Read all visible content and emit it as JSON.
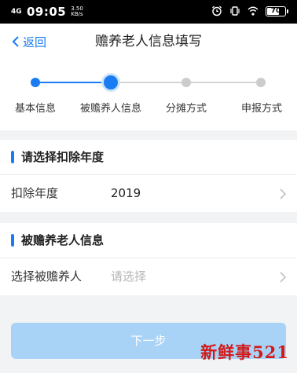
{
  "status_bar": {
    "network": "4G",
    "time": "09:05",
    "speed": "3.50 KB/s",
    "battery": "70"
  },
  "navbar": {
    "back_label": "返回",
    "title": "赡养老人信息填写"
  },
  "steps": [
    {
      "label": "基本信息",
      "state": "done"
    },
    {
      "label": "被赡养人信息",
      "state": "current"
    },
    {
      "label": "分摊方式",
      "state": "todo"
    },
    {
      "label": "申报方式",
      "state": "todo"
    }
  ],
  "section_year": {
    "title": "请选择扣除年度",
    "row_label": "扣除年度",
    "row_value": "2019"
  },
  "section_elder": {
    "title": "被赡养老人信息",
    "row_label": "选择被赡养人",
    "row_placeholder": "请选择"
  },
  "next_button": "下一步",
  "watermark": "新鲜事521",
  "colors": {
    "accent": "#1a7cf2",
    "inactive": "#cccccc",
    "button_disabled": "#a9d3f6",
    "watermark": "#d21a1a"
  }
}
